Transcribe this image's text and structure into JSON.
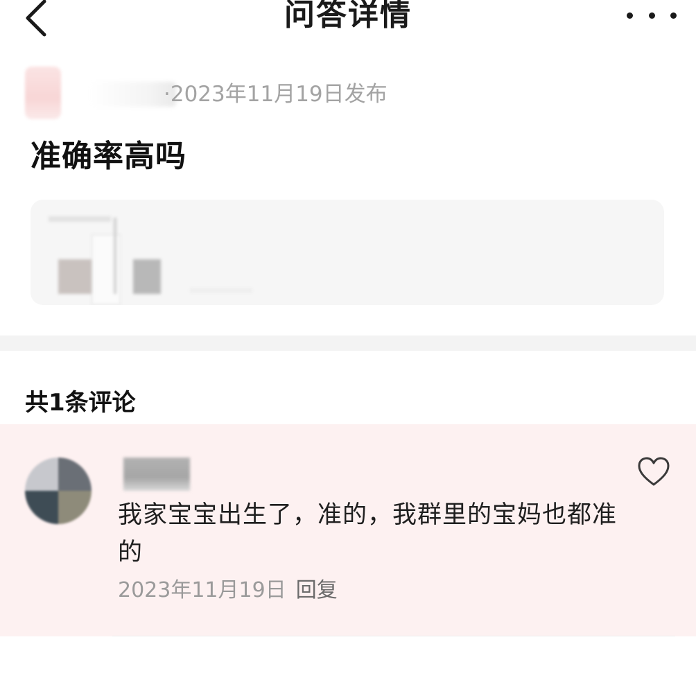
{
  "header": {
    "title": "问答详情",
    "back_icon": "chevron-left-icon",
    "more_icon": "more-horizontal-icon"
  },
  "post": {
    "meta": "·2023年11月19日发布",
    "question": "准确率高吗"
  },
  "comments": {
    "count_label": "共1条评论",
    "items": [
      {
        "text": "我家宝宝出生了，准的，我群里的宝妈也都准的",
        "date": "2023年11月19日",
        "reply_label": "回复",
        "like_icon": "heart-outline-icon"
      }
    ]
  },
  "colors": {
    "comment_highlight_bg": "#fdf1f1",
    "meta_text": "#a3a3a3",
    "divider": "#f3f3f3"
  }
}
